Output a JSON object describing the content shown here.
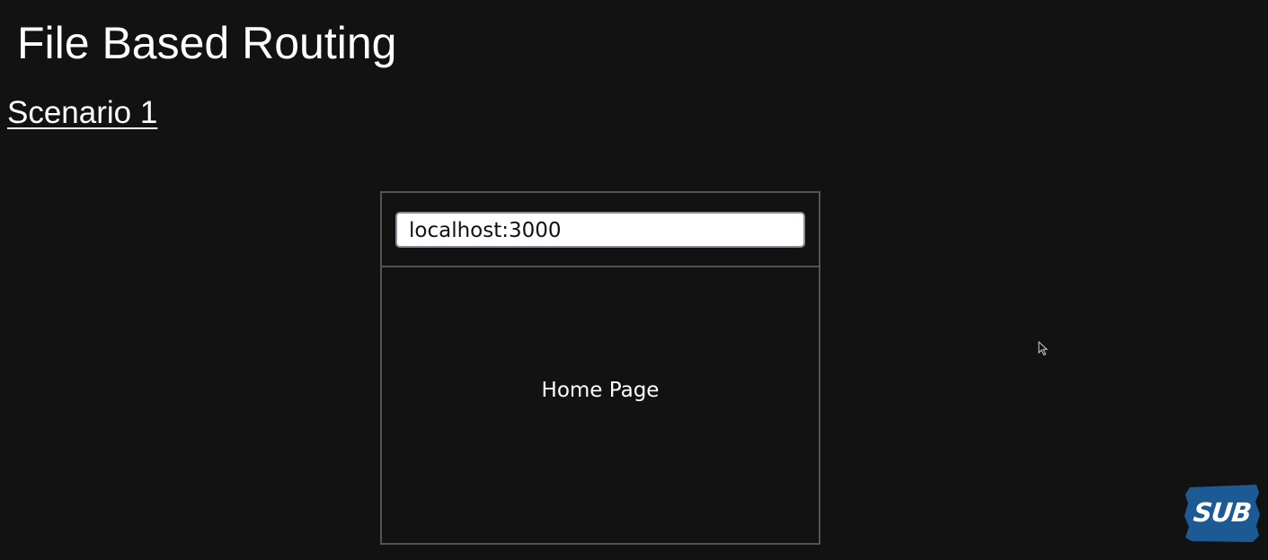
{
  "slide": {
    "title": "File Based Routing",
    "scenario": "Scenario 1"
  },
  "browser": {
    "address": "localhost:3000",
    "page_label": "Home Page"
  },
  "badge": {
    "label": "SUB",
    "color": "#1b5a94"
  },
  "icons": {
    "cursor": "mouse-pointer-icon"
  },
  "colors": {
    "background": "#121212",
    "frame_border": "#4d545c",
    "text": "#ffffff"
  }
}
